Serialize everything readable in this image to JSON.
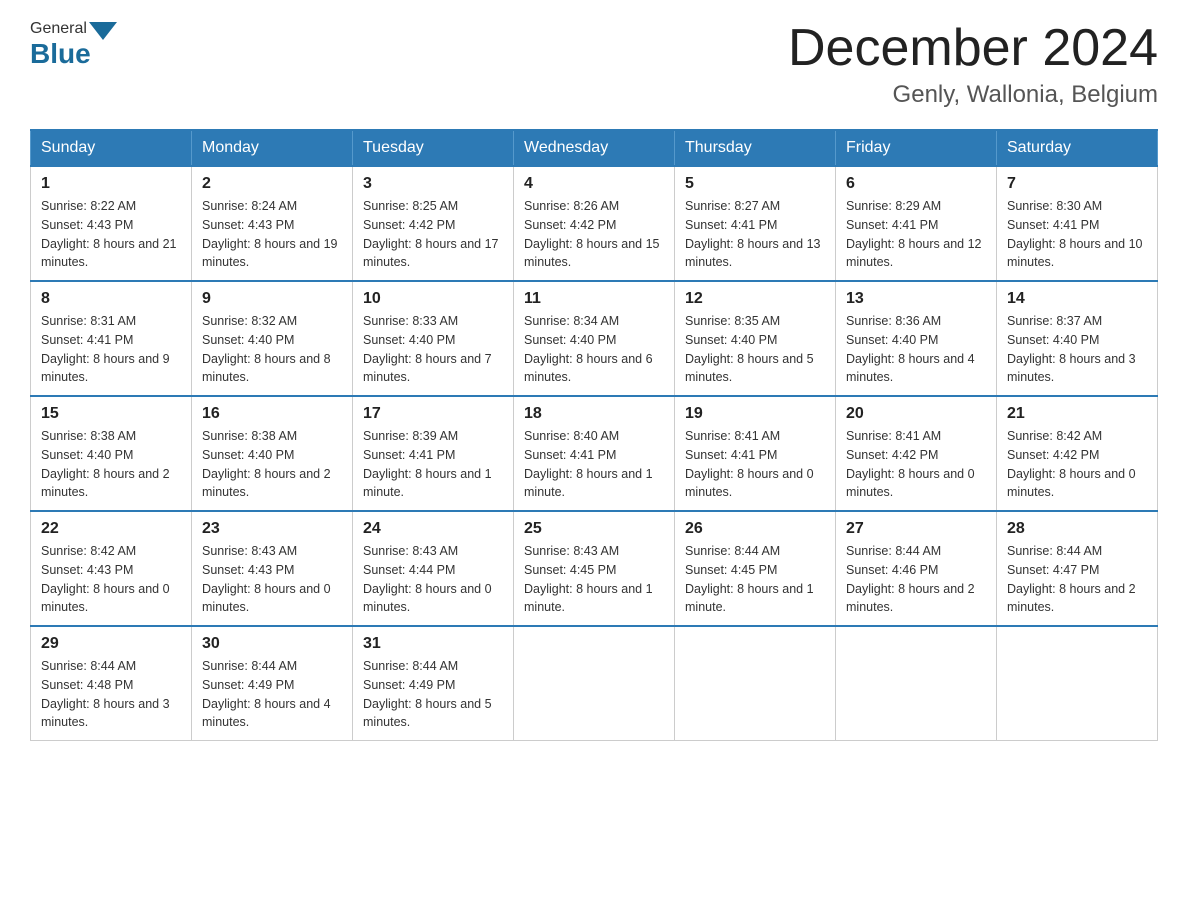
{
  "header": {
    "logo": {
      "general": "General",
      "blue": "Blue"
    },
    "month_title": "December 2024",
    "location": "Genly, Wallonia, Belgium"
  },
  "days_of_week": [
    "Sunday",
    "Monday",
    "Tuesday",
    "Wednesday",
    "Thursday",
    "Friday",
    "Saturday"
  ],
  "weeks": [
    [
      {
        "day": "1",
        "sunrise": "8:22 AM",
        "sunset": "4:43 PM",
        "daylight": "8 hours and 21 minutes."
      },
      {
        "day": "2",
        "sunrise": "8:24 AM",
        "sunset": "4:43 PM",
        "daylight": "8 hours and 19 minutes."
      },
      {
        "day": "3",
        "sunrise": "8:25 AM",
        "sunset": "4:42 PM",
        "daylight": "8 hours and 17 minutes."
      },
      {
        "day": "4",
        "sunrise": "8:26 AM",
        "sunset": "4:42 PM",
        "daylight": "8 hours and 15 minutes."
      },
      {
        "day": "5",
        "sunrise": "8:27 AM",
        "sunset": "4:41 PM",
        "daylight": "8 hours and 13 minutes."
      },
      {
        "day": "6",
        "sunrise": "8:29 AM",
        "sunset": "4:41 PM",
        "daylight": "8 hours and 12 minutes."
      },
      {
        "day": "7",
        "sunrise": "8:30 AM",
        "sunset": "4:41 PM",
        "daylight": "8 hours and 10 minutes."
      }
    ],
    [
      {
        "day": "8",
        "sunrise": "8:31 AM",
        "sunset": "4:41 PM",
        "daylight": "8 hours and 9 minutes."
      },
      {
        "day": "9",
        "sunrise": "8:32 AM",
        "sunset": "4:40 PM",
        "daylight": "8 hours and 8 minutes."
      },
      {
        "day": "10",
        "sunrise": "8:33 AM",
        "sunset": "4:40 PM",
        "daylight": "8 hours and 7 minutes."
      },
      {
        "day": "11",
        "sunrise": "8:34 AM",
        "sunset": "4:40 PM",
        "daylight": "8 hours and 6 minutes."
      },
      {
        "day": "12",
        "sunrise": "8:35 AM",
        "sunset": "4:40 PM",
        "daylight": "8 hours and 5 minutes."
      },
      {
        "day": "13",
        "sunrise": "8:36 AM",
        "sunset": "4:40 PM",
        "daylight": "8 hours and 4 minutes."
      },
      {
        "day": "14",
        "sunrise": "8:37 AM",
        "sunset": "4:40 PM",
        "daylight": "8 hours and 3 minutes."
      }
    ],
    [
      {
        "day": "15",
        "sunrise": "8:38 AM",
        "sunset": "4:40 PM",
        "daylight": "8 hours and 2 minutes."
      },
      {
        "day": "16",
        "sunrise": "8:38 AM",
        "sunset": "4:40 PM",
        "daylight": "8 hours and 2 minutes."
      },
      {
        "day": "17",
        "sunrise": "8:39 AM",
        "sunset": "4:41 PM",
        "daylight": "8 hours and 1 minute."
      },
      {
        "day": "18",
        "sunrise": "8:40 AM",
        "sunset": "4:41 PM",
        "daylight": "8 hours and 1 minute."
      },
      {
        "day": "19",
        "sunrise": "8:41 AM",
        "sunset": "4:41 PM",
        "daylight": "8 hours and 0 minutes."
      },
      {
        "day": "20",
        "sunrise": "8:41 AM",
        "sunset": "4:42 PM",
        "daylight": "8 hours and 0 minutes."
      },
      {
        "day": "21",
        "sunrise": "8:42 AM",
        "sunset": "4:42 PM",
        "daylight": "8 hours and 0 minutes."
      }
    ],
    [
      {
        "day": "22",
        "sunrise": "8:42 AM",
        "sunset": "4:43 PM",
        "daylight": "8 hours and 0 minutes."
      },
      {
        "day": "23",
        "sunrise": "8:43 AM",
        "sunset": "4:43 PM",
        "daylight": "8 hours and 0 minutes."
      },
      {
        "day": "24",
        "sunrise": "8:43 AM",
        "sunset": "4:44 PM",
        "daylight": "8 hours and 0 minutes."
      },
      {
        "day": "25",
        "sunrise": "8:43 AM",
        "sunset": "4:45 PM",
        "daylight": "8 hours and 1 minute."
      },
      {
        "day": "26",
        "sunrise": "8:44 AM",
        "sunset": "4:45 PM",
        "daylight": "8 hours and 1 minute."
      },
      {
        "day": "27",
        "sunrise": "8:44 AM",
        "sunset": "4:46 PM",
        "daylight": "8 hours and 2 minutes."
      },
      {
        "day": "28",
        "sunrise": "8:44 AM",
        "sunset": "4:47 PM",
        "daylight": "8 hours and 2 minutes."
      }
    ],
    [
      {
        "day": "29",
        "sunrise": "8:44 AM",
        "sunset": "4:48 PM",
        "daylight": "8 hours and 3 minutes."
      },
      {
        "day": "30",
        "sunrise": "8:44 AM",
        "sunset": "4:49 PM",
        "daylight": "8 hours and 4 minutes."
      },
      {
        "day": "31",
        "sunrise": "8:44 AM",
        "sunset": "4:49 PM",
        "daylight": "8 hours and 5 minutes."
      },
      null,
      null,
      null,
      null
    ]
  ],
  "labels": {
    "sunrise": "Sunrise:",
    "sunset": "Sunset:",
    "daylight": "Daylight:"
  }
}
